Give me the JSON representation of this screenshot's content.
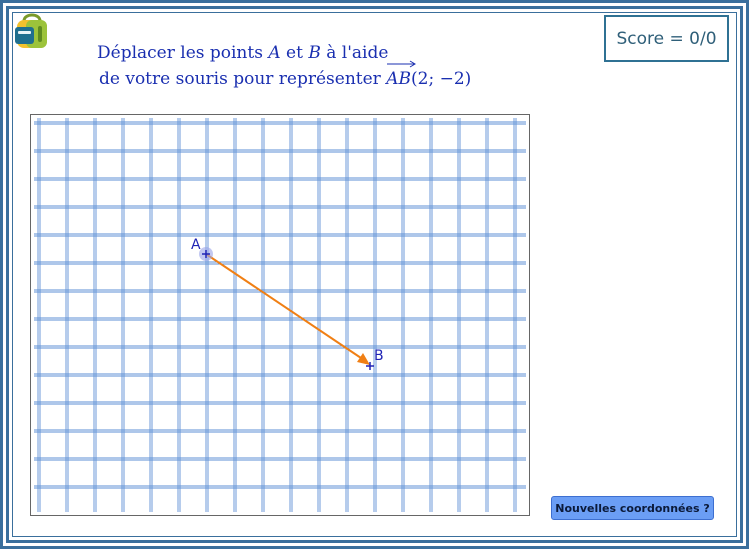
{
  "instruction": {
    "line1_before": "Déplacer les points ",
    "point_a": "A",
    "and": " et ",
    "point_b": "B",
    "line1_after": " à l'aide",
    "line2_before": "de votre souris pour représenter ",
    "vector": "AB",
    "coords": "(2; −2)"
  },
  "score": {
    "label": "Score = 0/0"
  },
  "graph": {
    "point_a_label": "A",
    "point_b_label": "B"
  },
  "new_coords_button": {
    "label": "Nouvelles coordonnées ?"
  },
  "colors": {
    "grid": "#5c8fd6",
    "vector": "#f07f14",
    "point": "#1f23b5",
    "frame": "#3a6f9c",
    "button": "#6b9ef5"
  }
}
